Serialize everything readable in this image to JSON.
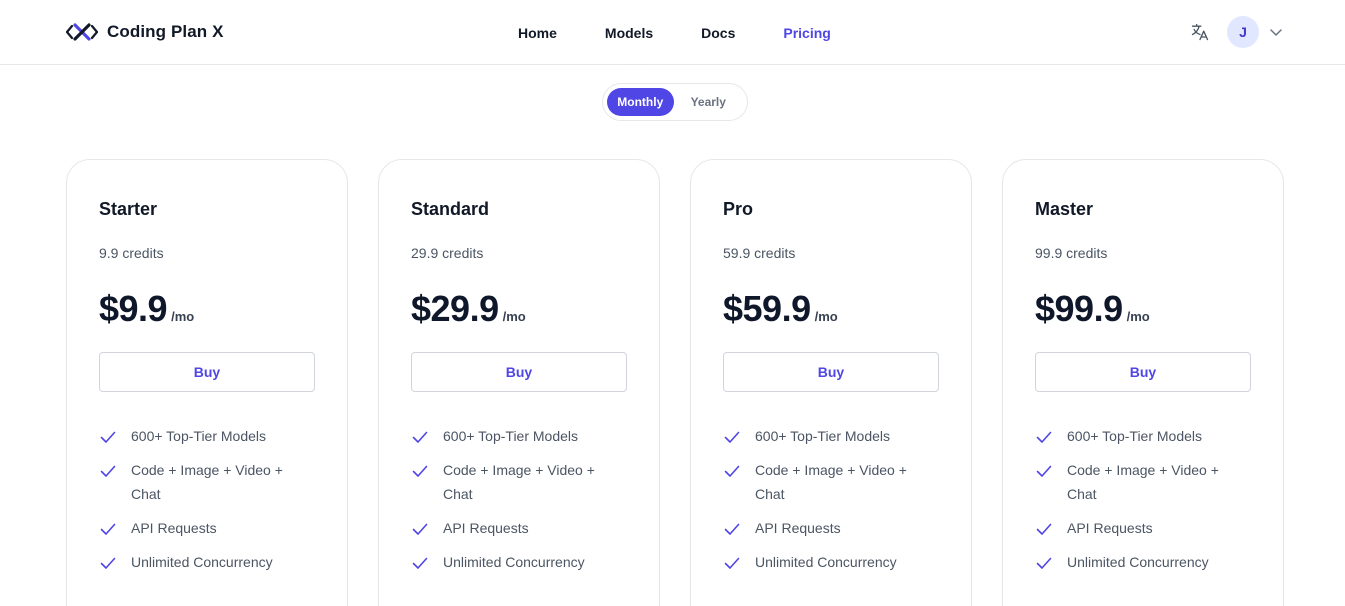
{
  "brand": {
    "name": "Coding Plan X",
    "logo_icon": "x-logo-icon",
    "accent_color": "#4f46e5"
  },
  "nav": {
    "home": "Home",
    "models": "Models",
    "docs": "Docs",
    "pricing": "Pricing"
  },
  "header": {
    "translate_icon": "translate-icon",
    "avatar_initial": "J",
    "chevron_icon": "chevron-down-icon"
  },
  "billing": {
    "monthly": "Monthly",
    "yearly": "Yearly",
    "selected": "Monthly"
  },
  "plans": [
    {
      "name": "Starter",
      "credits": "9.9 credits",
      "price": "$9.9",
      "period": "/mo",
      "cta": "Buy",
      "features": [
        "600+ Top-Tier Models",
        "Code + Image + Video + Chat",
        "API Requests",
        "Unlimited Concurrency"
      ]
    },
    {
      "name": "Standard",
      "credits": "29.9 credits",
      "price": "$29.9",
      "period": "/mo",
      "cta": "Buy",
      "features": [
        "600+ Top-Tier Models",
        "Code + Image + Video + Chat",
        "API Requests",
        "Unlimited Concurrency"
      ]
    },
    {
      "name": "Pro",
      "credits": "59.9 credits",
      "price": "$59.9",
      "period": "/mo",
      "cta": "Buy",
      "features": [
        "600+ Top-Tier Models",
        "Code + Image + Video + Chat",
        "API Requests",
        "Unlimited Concurrency"
      ]
    },
    {
      "name": "Master",
      "credits": "99.9 credits",
      "price": "$99.9",
      "period": "/mo",
      "cta": "Buy",
      "features": [
        "600+ Top-Tier Models",
        "Code + Image + Video + Chat",
        "API Requests",
        "Unlimited Concurrency"
      ]
    }
  ]
}
